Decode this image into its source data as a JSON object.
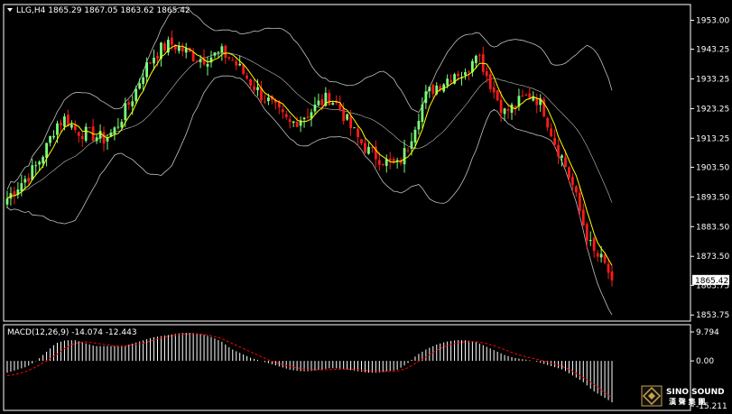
{
  "header": {
    "symbol_line": "LLG,H4  1865.29 1867.05 1863.62 1865.42"
  },
  "macd_header": {
    "label": "MACD(12,26,9) -14.074 -12.443"
  },
  "watermark": {
    "brand": "SINO SOUND",
    "sub": "漢 聲 集 團"
  },
  "colors": {
    "background": "#000000",
    "bull": "#7cff7c",
    "bear": "#ff1a1a",
    "ma": "#ffff00",
    "bands": "#c0c0c0",
    "macd_hist": "#ffffff",
    "macd_signal": "#ff0000",
    "price_tag_bg": "#ffffff"
  },
  "chart_data": [
    {
      "type": "candlestick",
      "title": "LLG,H4",
      "ohlc_last": {
        "open": 1865.29,
        "high": 1867.05,
        "low": 1863.62,
        "close": 1865.42
      },
      "current_price_label": "1865.42",
      "y_ticks": [
        "1953.00",
        "1943.25",
        "1933.25",
        "1923.25",
        "1913.25",
        "1903.50",
        "1893.50",
        "1883.50",
        "1873.50",
        "1863.75",
        "1853.75"
      ],
      "ylim": [
        1852,
        1958
      ],
      "close_path": [
        1893,
        1897,
        1900,
        1904,
        1910,
        1918,
        1920,
        1916,
        1915,
        1914,
        1913,
        1916,
        1922,
        1928,
        1936,
        1941,
        1944,
        1945,
        1943,
        1941,
        1940,
        1941,
        1942,
        1940,
        1936,
        1932,
        1928,
        1925,
        1921,
        1918,
        1920,
        1922,
        1925,
        1927,
        1924,
        1918,
        1913,
        1909,
        1907,
        1905,
        1904,
        1910,
        1920,
        1928,
        1931,
        1933,
        1936,
        1934,
        1944,
        1936,
        1928,
        1922,
        1924,
        1927,
        1928,
        1923,
        1913,
        1906,
        1897,
        1885,
        1875,
        1872,
        1866
      ],
      "indicators": [
        "Bollinger Bands",
        "Moving Average"
      ]
    },
    {
      "type": "bar",
      "title": "MACD(12,26,9)",
      "values_text": "-14.074 -12.443",
      "y_ticks": [
        "9.794",
        "0.00",
        "-15.211"
      ],
      "ylim": [
        -15.211,
        9.794
      ],
      "histogram": [
        -4,
        -3,
        -2,
        0,
        3,
        6,
        7,
        7,
        6,
        5,
        5,
        5,
        5,
        6,
        7,
        8,
        8.5,
        9,
        9.5,
        9.5,
        9,
        8,
        6.5,
        4,
        2.5,
        1,
        0,
        -1,
        -2,
        -3,
        -3.5,
        -3.5,
        -3,
        -2.5,
        -2.5,
        -3,
        -3.5,
        -4,
        -4,
        -3.5,
        -3,
        -1,
        2,
        4,
        5.5,
        6.5,
        7,
        7,
        6.5,
        5,
        3.5,
        2,
        1,
        0.5,
        0,
        -1,
        -2,
        -3,
        -5,
        -7,
        -10,
        -12,
        -14
      ],
      "signal": [
        -5,
        -4.5,
        -3.5,
        -2,
        0,
        2,
        4.5,
        6,
        6.5,
        6,
        5.5,
        5,
        5,
        5.5,
        6,
        7,
        8,
        8.5,
        9,
        9.2,
        9,
        8.5,
        7.5,
        6,
        4.5,
        3,
        1.5,
        0,
        -1,
        -2,
        -2.5,
        -3,
        -3,
        -3,
        -2.8,
        -2.8,
        -3,
        -3.3,
        -3.6,
        -3.6,
        -3.4,
        -2.5,
        -0.5,
        1.5,
        3.5,
        5,
        6,
        6.5,
        6.5,
        6,
        5,
        3.8,
        2.5,
        1.5,
        0.8,
        0,
        -1,
        -2,
        -3.5,
        -5.5,
        -7.5,
        -10,
        -12.4
      ]
    }
  ]
}
